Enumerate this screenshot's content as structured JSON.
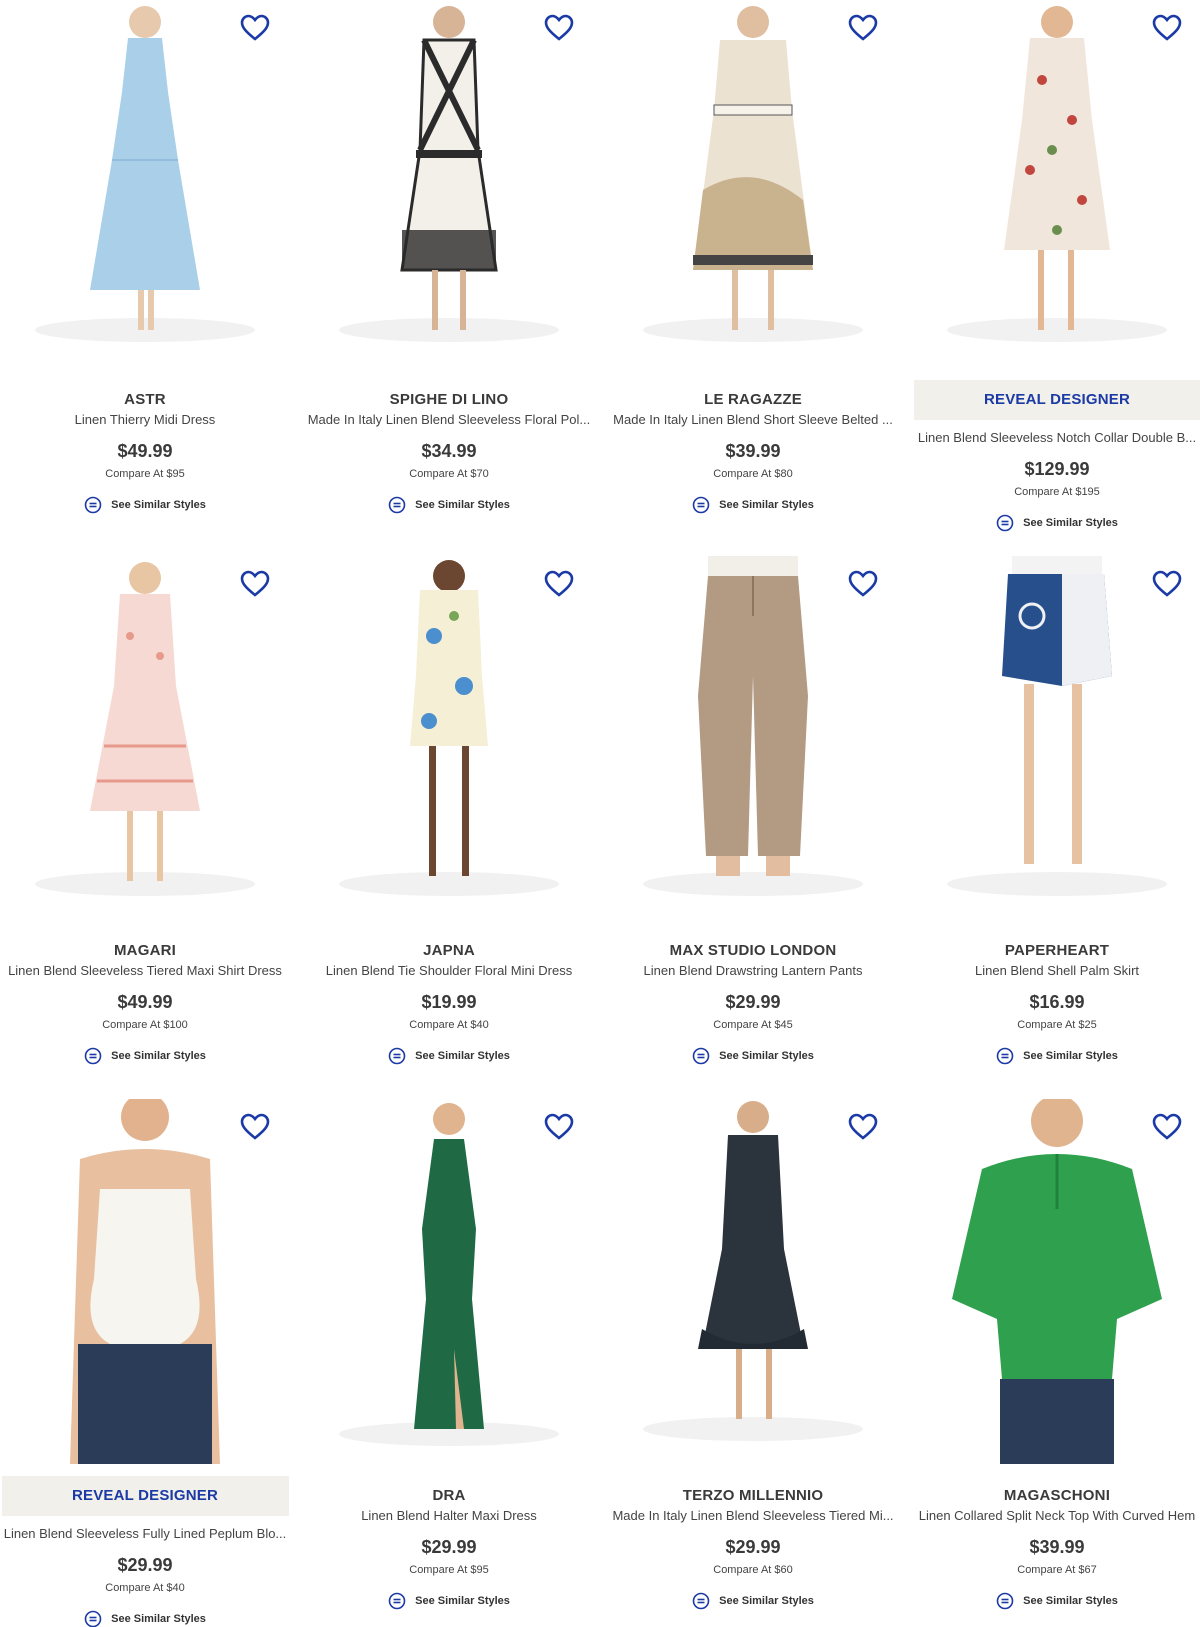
{
  "heart_icon_color": "#1b3aa6",
  "reveal_bg": "#f2f0ea",
  "products": [
    {
      "brand": "ASTR",
      "title": "Linen Thierry Midi Dress",
      "price": "$49.99",
      "compare": "Compare At  $95",
      "similar": "See Similar Styles",
      "garment_color": "#a9cfe9",
      "image": "light-blue-midi-dress"
    },
    {
      "brand": "SPIGHE DI LINO",
      "title": "Made In Italy Linen Blend Sleeveless Floral Pol...",
      "price": "$34.99",
      "compare": "Compare At  $70",
      "similar": "See Similar Styles",
      "garment_color": "#2b2b2b",
      "image": "black-white-print-dress"
    },
    {
      "brand": "LE RAGAZZE",
      "title": "Made In Italy Linen Blend Short Sleeve Belted ...",
      "price": "$39.99",
      "compare": "Compare At  $80",
      "similar": "See Similar Styles",
      "garment_color": "#d8c3a3",
      "image": "scenic-print-belted-dress"
    },
    {
      "reveal": "REVEAL DESIGNER",
      "title": "Linen Blend Sleeveless Notch Collar Double B...",
      "price": "$129.99",
      "compare": "Compare At  $195",
      "similar": "See Similar Styles",
      "garment_color": "#f1e6dc",
      "image": "floral-shirt-dress"
    },
    {
      "brand": "MAGARI",
      "title": "Linen Blend Sleeveless Tiered Maxi Shirt Dress",
      "price": "$49.99",
      "compare": "Compare At  $100",
      "similar": "See Similar Styles",
      "garment_color": "#f3c8c0",
      "image": "pink-tiered-dress"
    },
    {
      "brand": "JAPNA",
      "title": "Linen Blend Tie Shoulder Floral Mini Dress",
      "price": "$19.99",
      "compare": "Compare At  $40",
      "similar": "See Similar Styles",
      "garment_color": "#f4efd5",
      "image": "floral-mini-dress"
    },
    {
      "brand": "MAX STUDIO LONDON",
      "title": "Linen Blend Drawstring Lantern Pants",
      "price": "$29.99",
      "compare": "Compare At  $45",
      "similar": "See Similar Styles",
      "garment_color": "#b39a82",
      "image": "tan-lantern-pants"
    },
    {
      "brand": "PAPERHEART",
      "title": "Linen Blend Shell Palm Skirt",
      "price": "$16.99",
      "compare": "Compare At  $25",
      "similar": "See Similar Styles",
      "garment_color": "#264f8c",
      "image": "blue-palm-skirt"
    },
    {
      "reveal": "REVEAL DESIGNER",
      "title": "Linen Blend Sleeveless Fully Lined Peplum Blo...",
      "price": "$29.99",
      "compare": "Compare At  $40",
      "similar": "See Similar Styles",
      "garment_color": "#f7f5f0",
      "image": "white-peplum-top"
    },
    {
      "brand": "DRA",
      "title": "Linen Blend Halter Maxi Dress",
      "price": "$29.99",
      "compare": "Compare At  $95",
      "similar": "See Similar Styles",
      "garment_color": "#1f6a45",
      "image": "green-halter-maxi"
    },
    {
      "brand": "TERZO MILLENNIO",
      "title": "Made In Italy Linen Blend Sleeveless Tiered Mi...",
      "price": "$29.99",
      "compare": "Compare At  $60",
      "similar": "See Similar Styles",
      "garment_color": "#2b333d",
      "image": "navy-tiered-dress"
    },
    {
      "brand": "MAGASCHONI",
      "title": "Linen Collared Split Neck Top With Curved Hem",
      "price": "$39.99",
      "compare": "Compare At  $67",
      "similar": "See Similar Styles",
      "garment_color": "#2fa14e",
      "image": "green-split-neck-top"
    }
  ]
}
